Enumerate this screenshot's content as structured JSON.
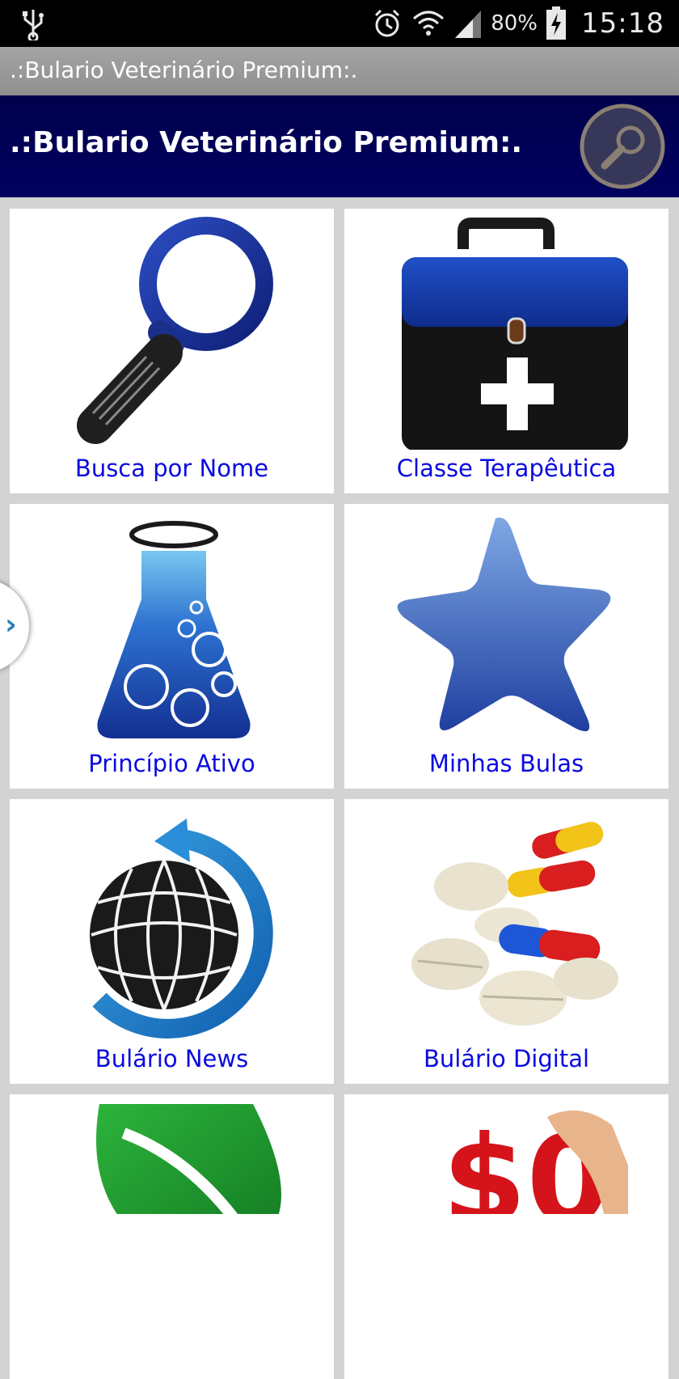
{
  "status_bar": {
    "battery_percent": "80%",
    "time": "15:18",
    "icons": [
      "usb-icon",
      "alarm-icon",
      "wifi-icon",
      "signal-icon",
      "battery-charging-icon"
    ]
  },
  "title_bar": {
    "title": ".:Bulario Veterinário Premium:."
  },
  "header": {
    "title": ".:Bulario Veterinário Premium:.",
    "search_icon": "search-icon"
  },
  "menu": [
    {
      "label": "Busca por Nome",
      "icon": "magnifier-icon"
    },
    {
      "label": "Classe Terapêutica",
      "icon": "medical-kit-icon"
    },
    {
      "label": "Princípio Ativo",
      "icon": "flask-icon"
    },
    {
      "label": "Minhas Bulas",
      "icon": "star-icon"
    },
    {
      "label": "Bulário News",
      "icon": "globe-refresh-icon"
    },
    {
      "label": "Bulário Digital",
      "icon": "pills-icon"
    },
    {
      "label": "",
      "icon": "leaf-icon"
    },
    {
      "label": "",
      "icon": "price-zero-icon"
    }
  ],
  "colors": {
    "header_bg": "#00005a",
    "label": "#0a0ae0",
    "icon_blue": "#1c3c96"
  }
}
